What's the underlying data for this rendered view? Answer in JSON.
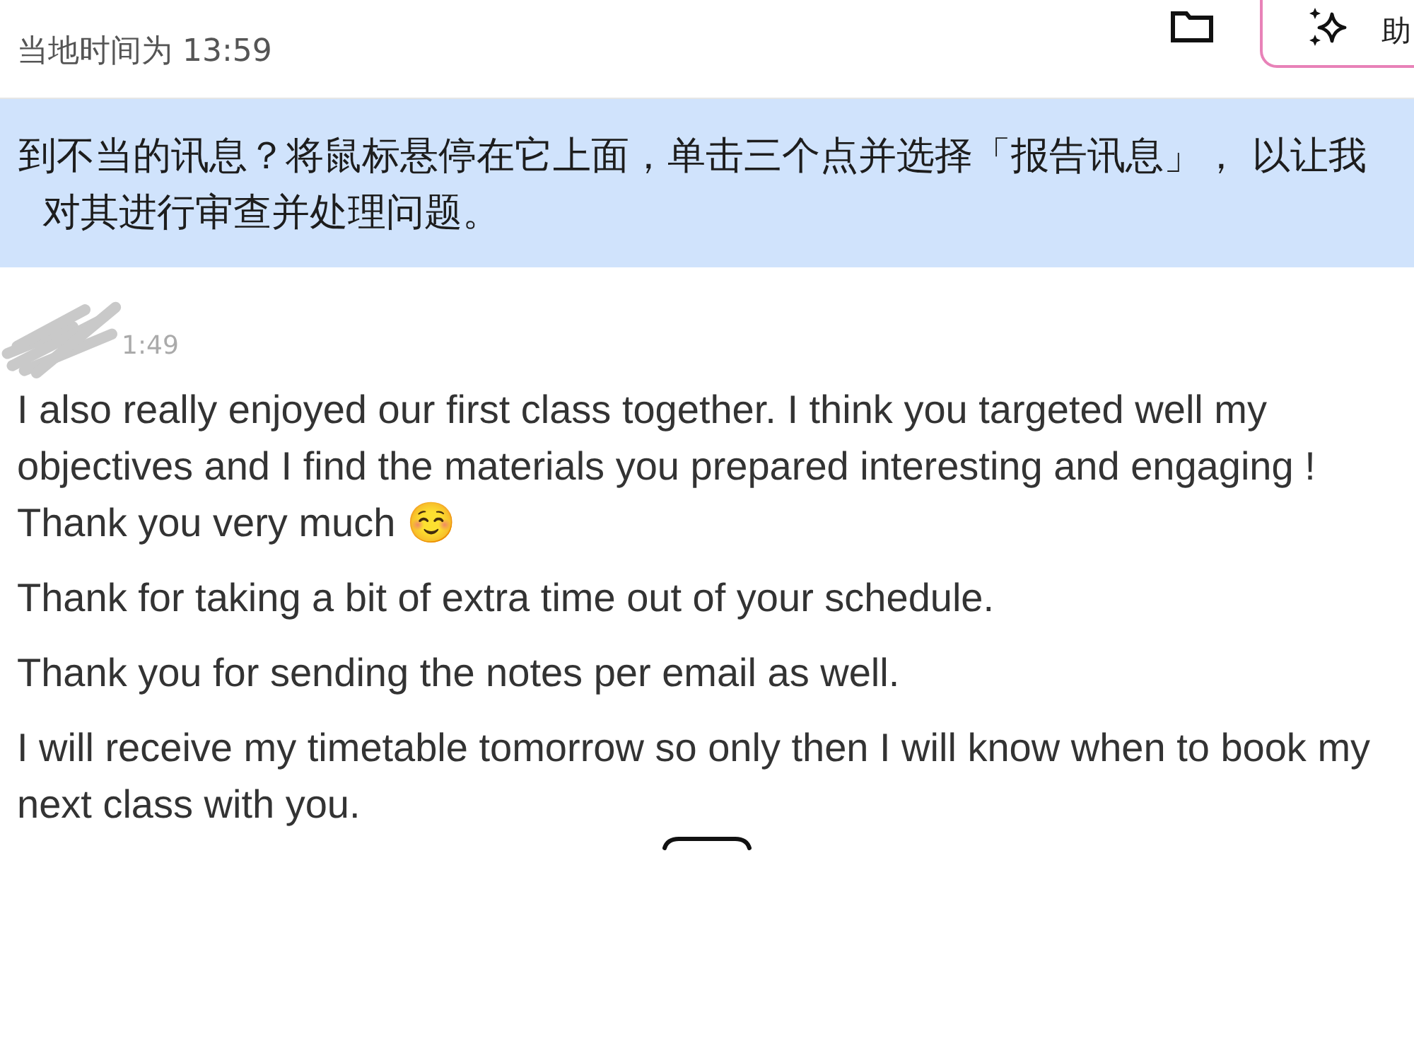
{
  "header": {
    "local_time": "当地时间为 13:59",
    "assistant_button": {
      "label": "助"
    }
  },
  "notice": {
    "lines": [
      "到不当的讯息？将鼠标悬停在它上面，单击三个点并选择「报告讯息」， 以让我",
      "对其进行审查并处理问题。"
    ]
  },
  "message": {
    "timestamp": "1:49",
    "paragraphs": [
      "I also really enjoyed our first class together. I think you targeted well my objectives and I find the materials you prepared interesting and engaging ! Thank you very much ☺️",
      "Thank for taking a bit of extra time out of your schedule.",
      "Thank you for sending the notes per email as well.",
      "I will receive my timetable tomorrow so only then I will know when to book my next class with you."
    ]
  }
}
